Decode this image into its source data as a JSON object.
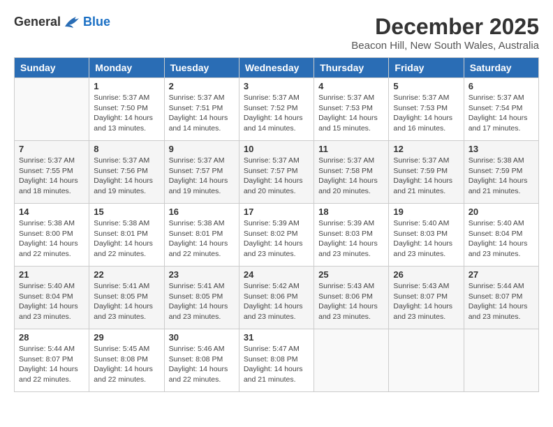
{
  "logo": {
    "general": "General",
    "blue": "Blue"
  },
  "title": "December 2025",
  "subtitle": "Beacon Hill, New South Wales, Australia",
  "headers": [
    "Sunday",
    "Monday",
    "Tuesday",
    "Wednesday",
    "Thursday",
    "Friday",
    "Saturday"
  ],
  "weeks": [
    [
      {
        "day": "",
        "info": ""
      },
      {
        "day": "1",
        "info": "Sunrise: 5:37 AM\nSunset: 7:50 PM\nDaylight: 14 hours\nand 13 minutes."
      },
      {
        "day": "2",
        "info": "Sunrise: 5:37 AM\nSunset: 7:51 PM\nDaylight: 14 hours\nand 14 minutes."
      },
      {
        "day": "3",
        "info": "Sunrise: 5:37 AM\nSunset: 7:52 PM\nDaylight: 14 hours\nand 14 minutes."
      },
      {
        "day": "4",
        "info": "Sunrise: 5:37 AM\nSunset: 7:53 PM\nDaylight: 14 hours\nand 15 minutes."
      },
      {
        "day": "5",
        "info": "Sunrise: 5:37 AM\nSunset: 7:53 PM\nDaylight: 14 hours\nand 16 minutes."
      },
      {
        "day": "6",
        "info": "Sunrise: 5:37 AM\nSunset: 7:54 PM\nDaylight: 14 hours\nand 17 minutes."
      }
    ],
    [
      {
        "day": "7",
        "info": "Sunrise: 5:37 AM\nSunset: 7:55 PM\nDaylight: 14 hours\nand 18 minutes."
      },
      {
        "day": "8",
        "info": "Sunrise: 5:37 AM\nSunset: 7:56 PM\nDaylight: 14 hours\nand 19 minutes."
      },
      {
        "day": "9",
        "info": "Sunrise: 5:37 AM\nSunset: 7:57 PM\nDaylight: 14 hours\nand 19 minutes."
      },
      {
        "day": "10",
        "info": "Sunrise: 5:37 AM\nSunset: 7:57 PM\nDaylight: 14 hours\nand 20 minutes."
      },
      {
        "day": "11",
        "info": "Sunrise: 5:37 AM\nSunset: 7:58 PM\nDaylight: 14 hours\nand 20 minutes."
      },
      {
        "day": "12",
        "info": "Sunrise: 5:37 AM\nSunset: 7:59 PM\nDaylight: 14 hours\nand 21 minutes."
      },
      {
        "day": "13",
        "info": "Sunrise: 5:38 AM\nSunset: 7:59 PM\nDaylight: 14 hours\nand 21 minutes."
      }
    ],
    [
      {
        "day": "14",
        "info": "Sunrise: 5:38 AM\nSunset: 8:00 PM\nDaylight: 14 hours\nand 22 minutes."
      },
      {
        "day": "15",
        "info": "Sunrise: 5:38 AM\nSunset: 8:01 PM\nDaylight: 14 hours\nand 22 minutes."
      },
      {
        "day": "16",
        "info": "Sunrise: 5:38 AM\nSunset: 8:01 PM\nDaylight: 14 hours\nand 22 minutes."
      },
      {
        "day": "17",
        "info": "Sunrise: 5:39 AM\nSunset: 8:02 PM\nDaylight: 14 hours\nand 23 minutes."
      },
      {
        "day": "18",
        "info": "Sunrise: 5:39 AM\nSunset: 8:03 PM\nDaylight: 14 hours\nand 23 minutes."
      },
      {
        "day": "19",
        "info": "Sunrise: 5:40 AM\nSunset: 8:03 PM\nDaylight: 14 hours\nand 23 minutes."
      },
      {
        "day": "20",
        "info": "Sunrise: 5:40 AM\nSunset: 8:04 PM\nDaylight: 14 hours\nand 23 minutes."
      }
    ],
    [
      {
        "day": "21",
        "info": "Sunrise: 5:40 AM\nSunset: 8:04 PM\nDaylight: 14 hours\nand 23 minutes."
      },
      {
        "day": "22",
        "info": "Sunrise: 5:41 AM\nSunset: 8:05 PM\nDaylight: 14 hours\nand 23 minutes."
      },
      {
        "day": "23",
        "info": "Sunrise: 5:41 AM\nSunset: 8:05 PM\nDaylight: 14 hours\nand 23 minutes."
      },
      {
        "day": "24",
        "info": "Sunrise: 5:42 AM\nSunset: 8:06 PM\nDaylight: 14 hours\nand 23 minutes."
      },
      {
        "day": "25",
        "info": "Sunrise: 5:43 AM\nSunset: 8:06 PM\nDaylight: 14 hours\nand 23 minutes."
      },
      {
        "day": "26",
        "info": "Sunrise: 5:43 AM\nSunset: 8:07 PM\nDaylight: 14 hours\nand 23 minutes."
      },
      {
        "day": "27",
        "info": "Sunrise: 5:44 AM\nSunset: 8:07 PM\nDaylight: 14 hours\nand 23 minutes."
      }
    ],
    [
      {
        "day": "28",
        "info": "Sunrise: 5:44 AM\nSunset: 8:07 PM\nDaylight: 14 hours\nand 22 minutes."
      },
      {
        "day": "29",
        "info": "Sunrise: 5:45 AM\nSunset: 8:08 PM\nDaylight: 14 hours\nand 22 minutes."
      },
      {
        "day": "30",
        "info": "Sunrise: 5:46 AM\nSunset: 8:08 PM\nDaylight: 14 hours\nand 22 minutes."
      },
      {
        "day": "31",
        "info": "Sunrise: 5:47 AM\nSunset: 8:08 PM\nDaylight: 14 hours\nand 21 minutes."
      },
      {
        "day": "",
        "info": ""
      },
      {
        "day": "",
        "info": ""
      },
      {
        "day": "",
        "info": ""
      }
    ]
  ]
}
